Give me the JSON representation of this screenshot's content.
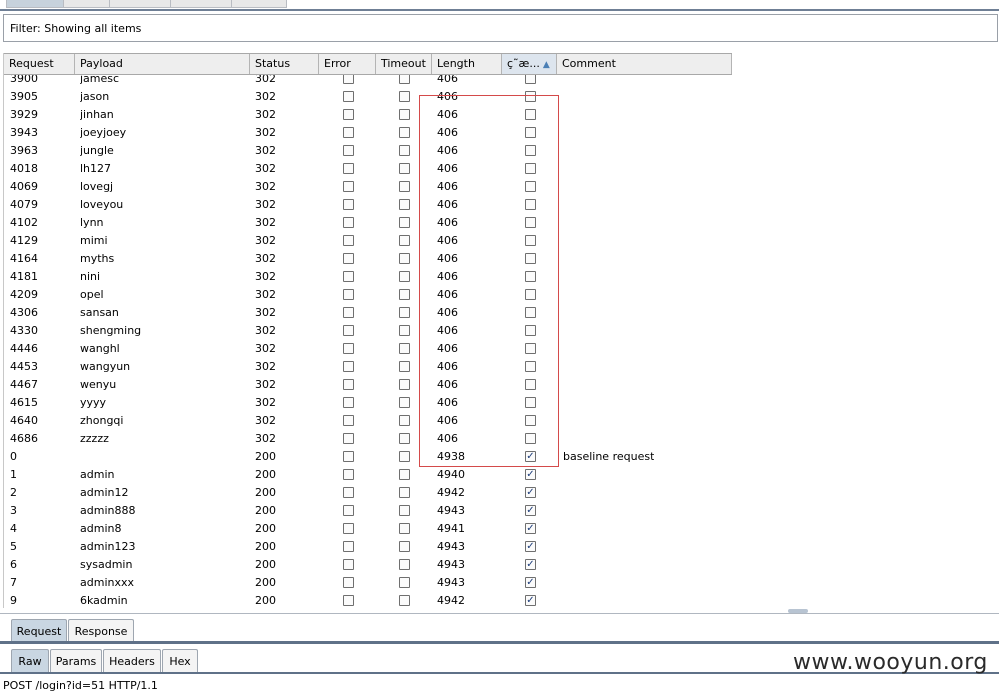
{
  "filter": {
    "label": "Filter:",
    "value": "Showing all items"
  },
  "table": {
    "columns": [
      {
        "key": "request",
        "label": "Request"
      },
      {
        "key": "payload",
        "label": "Payload"
      },
      {
        "key": "status",
        "label": "Status"
      },
      {
        "key": "error",
        "label": "Error"
      },
      {
        "key": "timeout",
        "label": "Timeout"
      },
      {
        "key": "length",
        "label": "Length"
      },
      {
        "key": "grep",
        "label": "ç˜æ...",
        "sorted": "ascending"
      },
      {
        "key": "comment",
        "label": "Comment"
      }
    ],
    "rows": [
      {
        "request": "3900",
        "payload": "jamesc",
        "status": "302",
        "error": false,
        "timeout": false,
        "length": "406",
        "grep": false,
        "comment": ""
      },
      {
        "request": "3905",
        "payload": "jason",
        "status": "302",
        "error": false,
        "timeout": false,
        "length": "406",
        "grep": false,
        "comment": ""
      },
      {
        "request": "3929",
        "payload": "jinhan",
        "status": "302",
        "error": false,
        "timeout": false,
        "length": "406",
        "grep": false,
        "comment": ""
      },
      {
        "request": "3943",
        "payload": "joeyjoey",
        "status": "302",
        "error": false,
        "timeout": false,
        "length": "406",
        "grep": false,
        "comment": ""
      },
      {
        "request": "3963",
        "payload": "jungle",
        "status": "302",
        "error": false,
        "timeout": false,
        "length": "406",
        "grep": false,
        "comment": ""
      },
      {
        "request": "4018",
        "payload": "lh127",
        "status": "302",
        "error": false,
        "timeout": false,
        "length": "406",
        "grep": false,
        "comment": ""
      },
      {
        "request": "4069",
        "payload": "lovegj",
        "status": "302",
        "error": false,
        "timeout": false,
        "length": "406",
        "grep": false,
        "comment": ""
      },
      {
        "request": "4079",
        "payload": "loveyou",
        "status": "302",
        "error": false,
        "timeout": false,
        "length": "406",
        "grep": false,
        "comment": ""
      },
      {
        "request": "4102",
        "payload": "lynn",
        "status": "302",
        "error": false,
        "timeout": false,
        "length": "406",
        "grep": false,
        "comment": ""
      },
      {
        "request": "4129",
        "payload": "mimi",
        "status": "302",
        "error": false,
        "timeout": false,
        "length": "406",
        "grep": false,
        "comment": ""
      },
      {
        "request": "4164",
        "payload": "myths",
        "status": "302",
        "error": false,
        "timeout": false,
        "length": "406",
        "grep": false,
        "comment": ""
      },
      {
        "request": "4181",
        "payload": "nini",
        "status": "302",
        "error": false,
        "timeout": false,
        "length": "406",
        "grep": false,
        "comment": ""
      },
      {
        "request": "4209",
        "payload": "opel",
        "status": "302",
        "error": false,
        "timeout": false,
        "length": "406",
        "grep": false,
        "comment": ""
      },
      {
        "request": "4306",
        "payload": "sansan",
        "status": "302",
        "error": false,
        "timeout": false,
        "length": "406",
        "grep": false,
        "comment": ""
      },
      {
        "request": "4330",
        "payload": "shengming",
        "status": "302",
        "error": false,
        "timeout": false,
        "length": "406",
        "grep": false,
        "comment": ""
      },
      {
        "request": "4446",
        "payload": "wanghl",
        "status": "302",
        "error": false,
        "timeout": false,
        "length": "406",
        "grep": false,
        "comment": ""
      },
      {
        "request": "4453",
        "payload": "wangyun",
        "status": "302",
        "error": false,
        "timeout": false,
        "length": "406",
        "grep": false,
        "comment": ""
      },
      {
        "request": "4467",
        "payload": "wenyu",
        "status": "302",
        "error": false,
        "timeout": false,
        "length": "406",
        "grep": false,
        "comment": ""
      },
      {
        "request": "4615",
        "payload": "yyyy",
        "status": "302",
        "error": false,
        "timeout": false,
        "length": "406",
        "grep": false,
        "comment": ""
      },
      {
        "request": "4640",
        "payload": "zhongqi",
        "status": "302",
        "error": false,
        "timeout": false,
        "length": "406",
        "grep": false,
        "comment": ""
      },
      {
        "request": "4686",
        "payload": "zzzzz",
        "status": "302",
        "error": false,
        "timeout": false,
        "length": "406",
        "grep": false,
        "comment": ""
      },
      {
        "request": "0",
        "payload": "",
        "status": "200",
        "error": false,
        "timeout": false,
        "length": "4938",
        "grep": true,
        "comment": "baseline request"
      },
      {
        "request": "1",
        "payload": "admin",
        "status": "200",
        "error": false,
        "timeout": false,
        "length": "4940",
        "grep": true,
        "comment": ""
      },
      {
        "request": "2",
        "payload": "admin12",
        "status": "200",
        "error": false,
        "timeout": false,
        "length": "4942",
        "grep": true,
        "comment": ""
      },
      {
        "request": "3",
        "payload": "admin888",
        "status": "200",
        "error": false,
        "timeout": false,
        "length": "4943",
        "grep": true,
        "comment": ""
      },
      {
        "request": "4",
        "payload": "admin8",
        "status": "200",
        "error": false,
        "timeout": false,
        "length": "4941",
        "grep": true,
        "comment": ""
      },
      {
        "request": "5",
        "payload": "admin123",
        "status": "200",
        "error": false,
        "timeout": false,
        "length": "4943",
        "grep": true,
        "comment": ""
      },
      {
        "request": "6",
        "payload": "sysadmin",
        "status": "200",
        "error": false,
        "timeout": false,
        "length": "4943",
        "grep": true,
        "comment": ""
      },
      {
        "request": "7",
        "payload": "adminxxx",
        "status": "200",
        "error": false,
        "timeout": false,
        "length": "4943",
        "grep": true,
        "comment": ""
      },
      {
        "request": "9",
        "payload": "6kadmin",
        "status": "200",
        "error": false,
        "timeout": false,
        "length": "4942",
        "grep": true,
        "comment": ""
      }
    ]
  },
  "message_tabs": [
    {
      "label": "Request",
      "active": true
    },
    {
      "label": "Response",
      "active": false
    }
  ],
  "format_tabs": [
    {
      "label": "Raw",
      "active": true
    },
    {
      "label": "Params",
      "active": false
    },
    {
      "label": "Headers",
      "active": false
    },
    {
      "label": "Hex",
      "active": false
    }
  ],
  "request_line": "POST /login?id=51 HTTP/1.1",
  "watermark": "www.wooyun.org",
  "icons": {
    "checkbox_checked": "check-icon",
    "sort": "sort-ascending-icon"
  },
  "colors": {
    "highlight_border": "#d44a4a",
    "active_tab": "#c9d6e2",
    "rule": "#5f7188"
  }
}
